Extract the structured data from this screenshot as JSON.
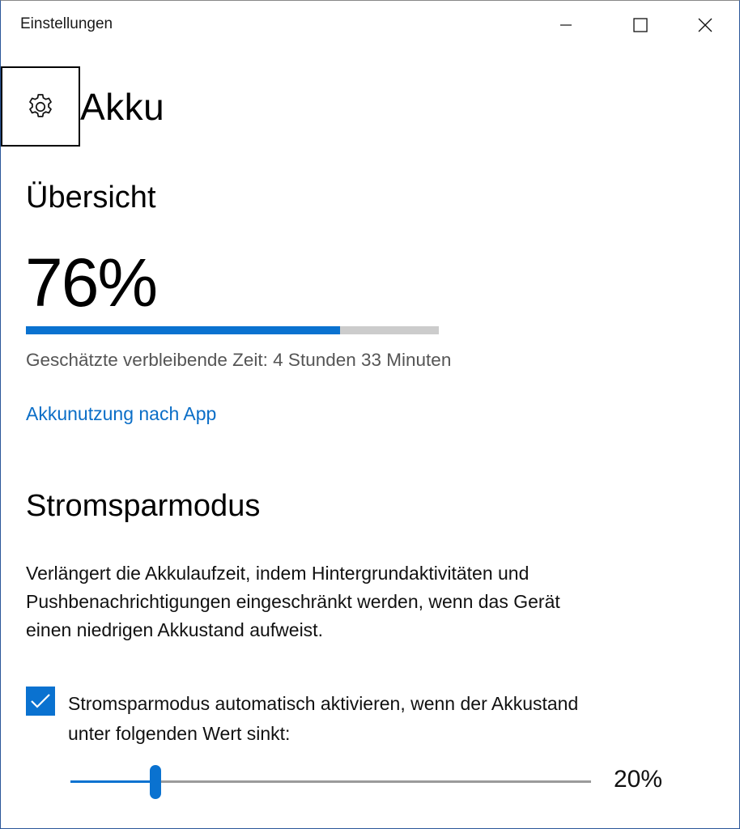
{
  "window": {
    "title": "Einstellungen",
    "controls": [
      "minimize-icon",
      "maximize-icon",
      "close-icon"
    ]
  },
  "header": {
    "icon": "gear-icon",
    "title": "Akku"
  },
  "overview": {
    "heading": "Übersicht",
    "percent_text": "76%",
    "percent_value": 0.76,
    "remaining_text": "Geschätzte verbleibende Zeit: 4 Stunden 33 Minuten",
    "usage_link": "Akkunutzung nach App"
  },
  "saver": {
    "heading": "Stromsparmodus",
    "description_lines": [
      "Verlängert die Akkulaufzeit, indem Hintergrundaktivitäten und",
      "Pushbenachrichtigungen eingeschränkt werden, wenn das Gerät",
      "einen niedrigen Akkustand aufweist."
    ],
    "auto_checkbox": {
      "checked": true,
      "label_lines": [
        "Stromsparmodus automatisch aktivieren, wenn der Akkustand",
        "unter folgenden Wert sinkt:"
      ]
    },
    "threshold_slider": {
      "value_text": "20%",
      "value": 0.2
    }
  },
  "colors": {
    "accent": "#0a72d0",
    "link": "#0b6ec7",
    "track": "#cccccc",
    "muted_text": "#555555"
  }
}
